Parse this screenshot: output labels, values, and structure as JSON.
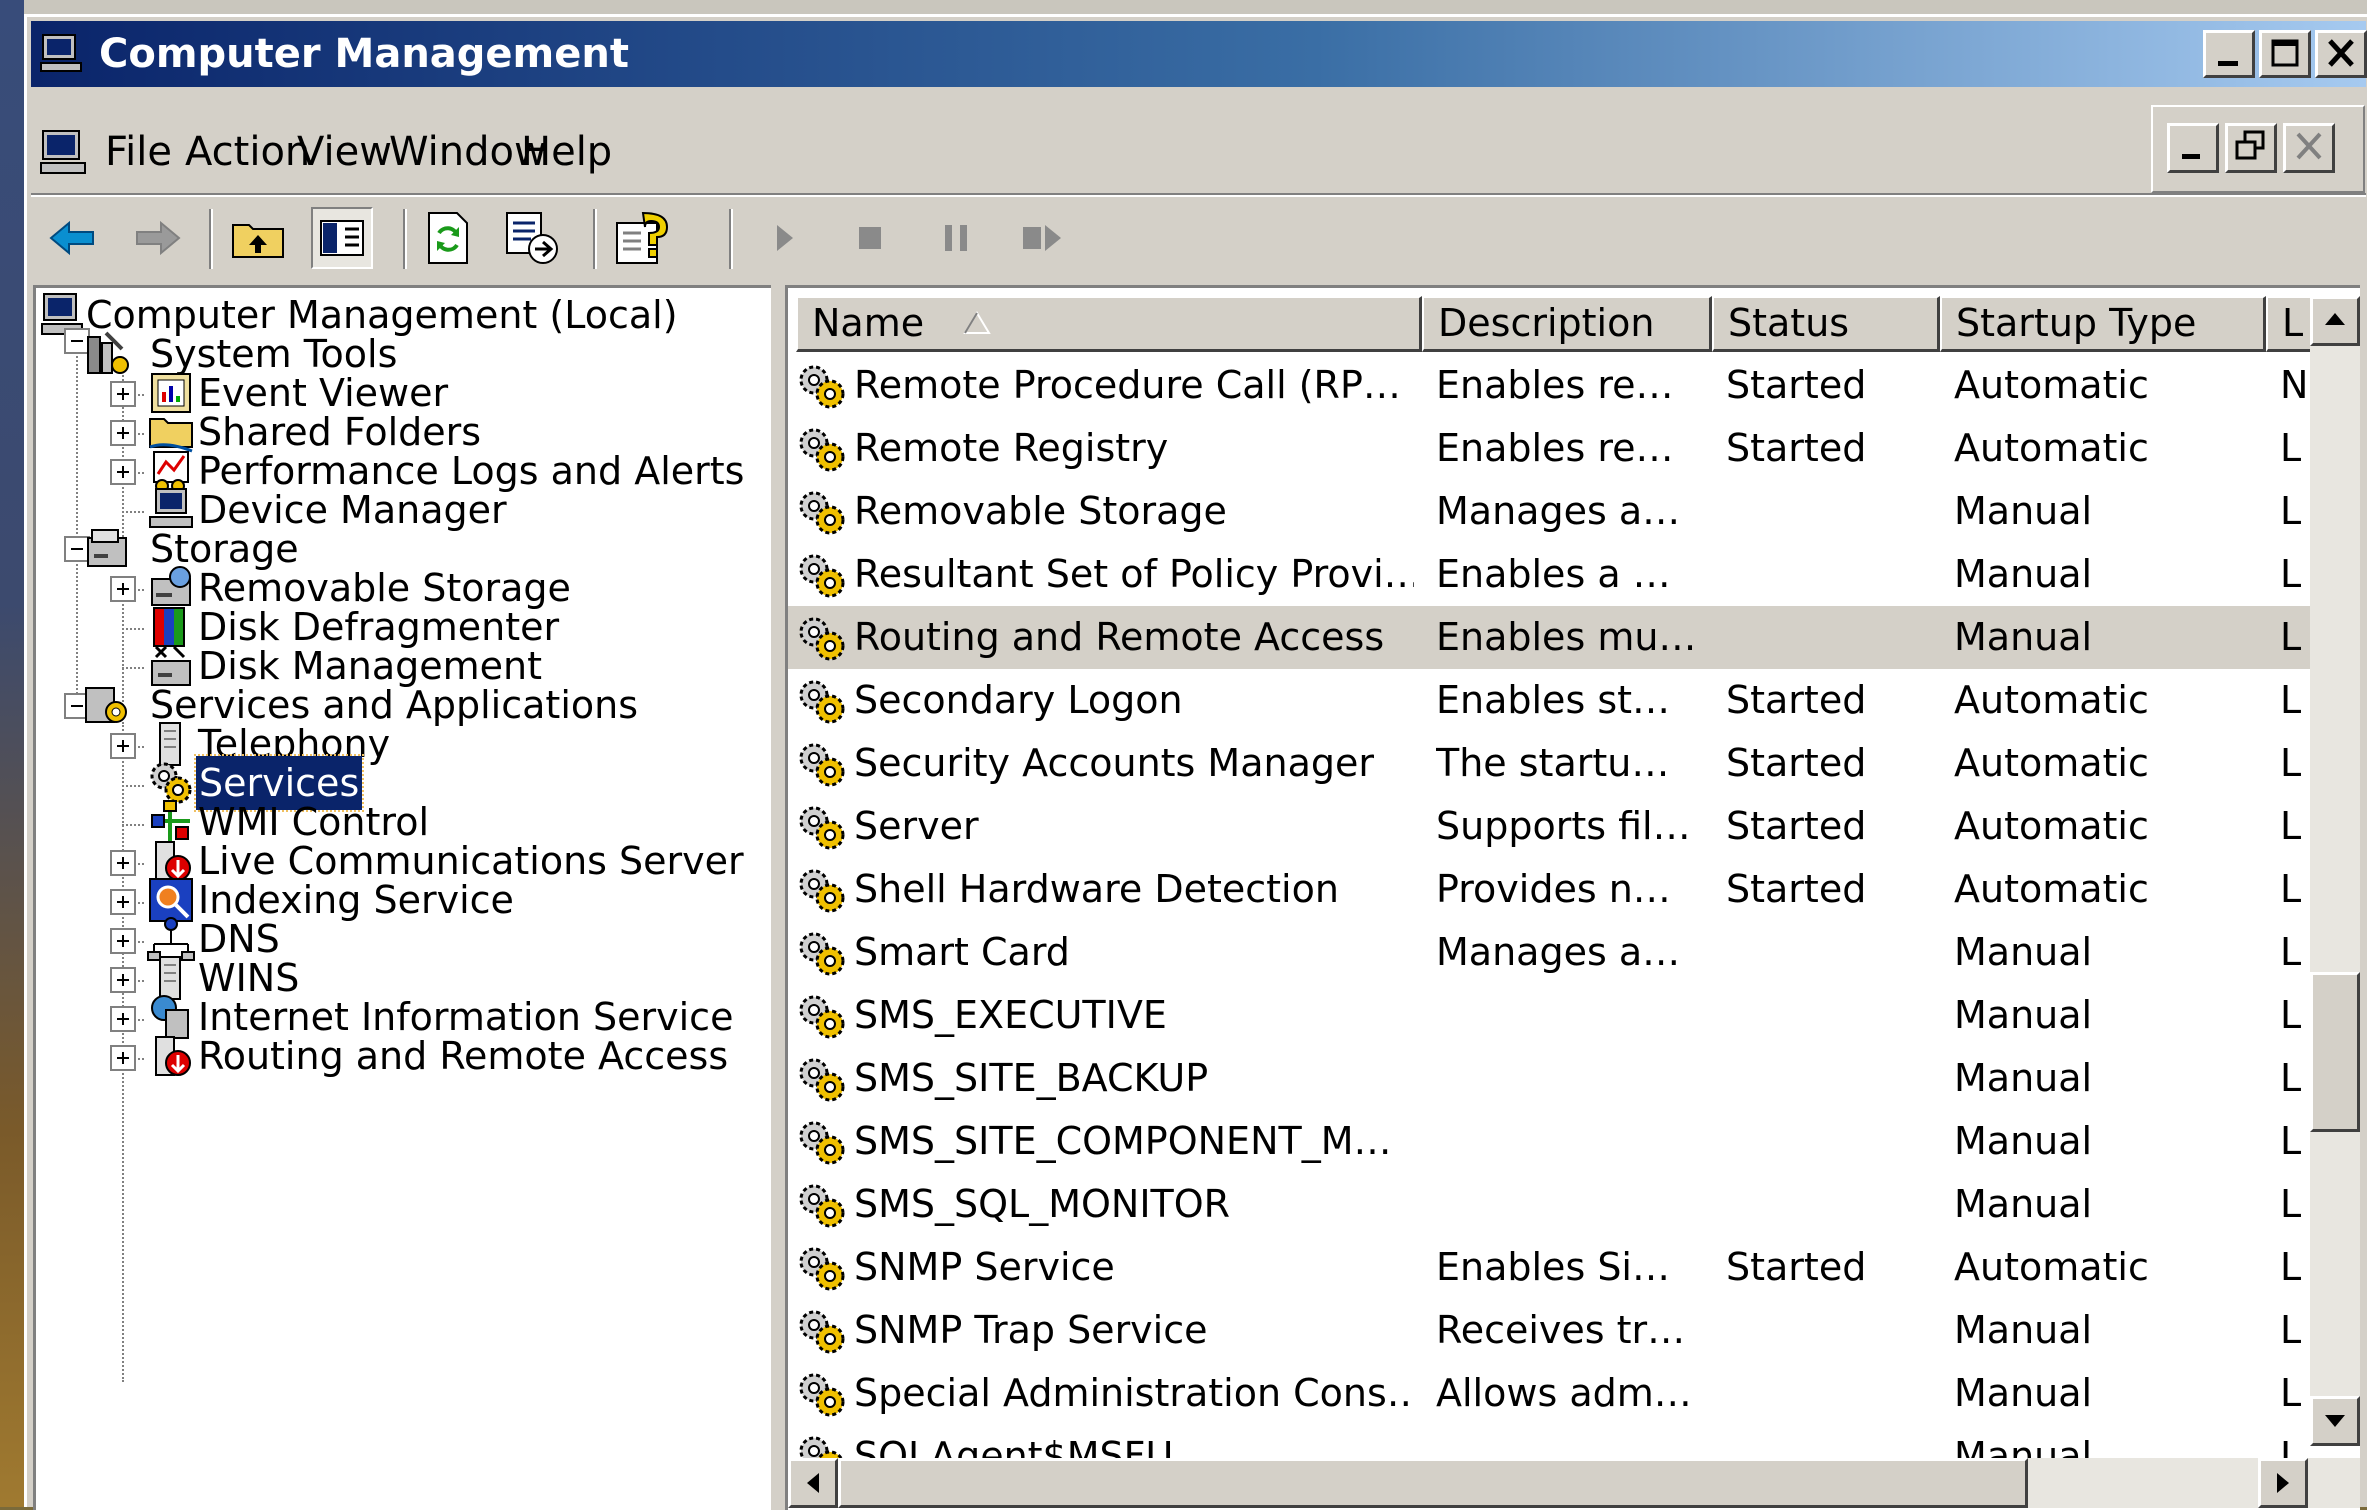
{
  "window": {
    "title": "Computer Management"
  },
  "menu": [
    "File",
    "Action",
    "View",
    "Window",
    "Help"
  ],
  "toolbar": {
    "buttons": [
      "back-icon",
      "forward-icon",
      "up-one-level-icon",
      "show-hide-console-tree-icon",
      "refresh-icon",
      "export-list-icon",
      "help-icon",
      "start-service-icon",
      "stop-service-icon",
      "pause-service-icon",
      "restart-service-icon"
    ]
  },
  "tree": {
    "root": "Computer Management (Local)",
    "system_tools": "System Tools",
    "event_viewer": "Event Viewer",
    "shared_folders": "Shared Folders",
    "perf_logs": "Performance Logs and Alerts",
    "device_manager": "Device Manager",
    "storage": "Storage",
    "removable_storage": "Removable Storage",
    "disk_defrag": "Disk Defragmenter",
    "disk_management": "Disk Management",
    "services_apps": "Services and Applications",
    "telephony": "Telephony",
    "services": "Services",
    "wmi_control": "WMI Control",
    "live_comm": "Live Communications Server",
    "indexing": "Indexing Service",
    "dns": "DNS",
    "wins": "WINS",
    "iis": "Internet Information Service",
    "rras": "Routing and Remote Access"
  },
  "list": {
    "headers": {
      "name": "Name",
      "description": "Description",
      "status": "Status",
      "startup": "Startup Type",
      "logon": "L"
    },
    "rows": [
      {
        "name": "Remote Procedure Call (RP…",
        "description": "Enables re…",
        "status": "Started",
        "startup": "Automatic",
        "logon": "N"
      },
      {
        "name": "Remote Registry",
        "description": "Enables re…",
        "status": "Started",
        "startup": "Automatic",
        "logon": "L"
      },
      {
        "name": "Removable Storage",
        "description": "Manages a…",
        "status": "",
        "startup": "Manual",
        "logon": "L"
      },
      {
        "name": "Resultant Set of Policy Provi…",
        "description": "Enables a …",
        "status": "",
        "startup": "Manual",
        "logon": "L"
      },
      {
        "name": "Routing and Remote Access",
        "description": "Enables mu…",
        "status": "",
        "startup": "Manual",
        "logon": "L"
      },
      {
        "name": "Secondary Logon",
        "description": "Enables st…",
        "status": "Started",
        "startup": "Automatic",
        "logon": "L"
      },
      {
        "name": "Security Accounts Manager",
        "description": "The startu…",
        "status": "Started",
        "startup": "Automatic",
        "logon": "L"
      },
      {
        "name": "Server",
        "description": "Supports fil…",
        "status": "Started",
        "startup": "Automatic",
        "logon": "L"
      },
      {
        "name": "Shell Hardware Detection",
        "description": "Provides n…",
        "status": "Started",
        "startup": "Automatic",
        "logon": "L"
      },
      {
        "name": "Smart Card",
        "description": "Manages a…",
        "status": "",
        "startup": "Manual",
        "logon": "L"
      },
      {
        "name": "SMS_EXECUTIVE",
        "description": "",
        "status": "",
        "startup": "Manual",
        "logon": "L"
      },
      {
        "name": "SMS_SITE_BACKUP",
        "description": "",
        "status": "",
        "startup": "Manual",
        "logon": "L"
      },
      {
        "name": "SMS_SITE_COMPONENT_M…",
        "description": "",
        "status": "",
        "startup": "Manual",
        "logon": "L"
      },
      {
        "name": "SMS_SQL_MONITOR",
        "description": "",
        "status": "",
        "startup": "Manual",
        "logon": "L"
      },
      {
        "name": "SNMP Service",
        "description": "Enables Si…",
        "status": "Started",
        "startup": "Automatic",
        "logon": "L"
      },
      {
        "name": "SNMP Trap Service",
        "description": "Receives tr…",
        "status": "",
        "startup": "Manual",
        "logon": "L"
      },
      {
        "name": "Special Administration Cons…",
        "description": "Allows adm…",
        "status": "",
        "startup": "Manual",
        "logon": "L"
      },
      {
        "name": "SQLAgent$MSFU",
        "description": "",
        "status": "",
        "startup": "Manual",
        "logon": "L"
      }
    ]
  }
}
